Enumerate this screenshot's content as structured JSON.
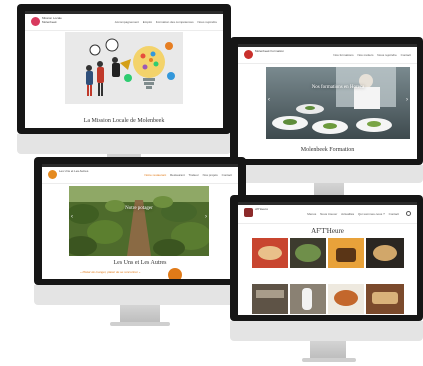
{
  "colors": {
    "bezel": "#161616",
    "chin": "#e4e4e4",
    "mission_logo": "#d83a5e",
    "formation_logo": "#c9302c",
    "uns_logo": "#e58a1f",
    "afheure_logo": "#8c2a2a",
    "accent_orange": "#e07a18"
  },
  "monitor1": {
    "logo_text": "Mission Locale Molenbeek",
    "menu": [
      "Accompagnement",
      "Emploi",
      "Formation des compétences",
      "Nous rejoindre"
    ],
    "caption": "La Mission Locale de Molenbeek"
  },
  "monitor2": {
    "logo_text": "Molenbeek Formation",
    "menu": [
      "Nos formations",
      "Nos métiers",
      "Nous rejoindre",
      "Contact"
    ],
    "hero_title": "Nos formations en Horeca",
    "caption": "Molenbeek Formation"
  },
  "monitor3": {
    "logo_text": "Les Uns et Les Autres",
    "menu": [
      "Notre restaurant",
      "Restaurant",
      "Traiteur",
      "Nos projets",
      "Contact"
    ],
    "hero_title": "Notre potager",
    "caption": "Les Uns et Les Autres",
    "tagline": "« Plaisir de manger, plaisir de se rencontrer »"
  },
  "monitor4": {
    "logo_text": "Af't'Heure",
    "menu": [
      "Menus",
      "Nous trouver",
      "Actualités",
      "Qui sommes-nous ?",
      "Contact"
    ],
    "caption": "AF'T'Heure"
  }
}
